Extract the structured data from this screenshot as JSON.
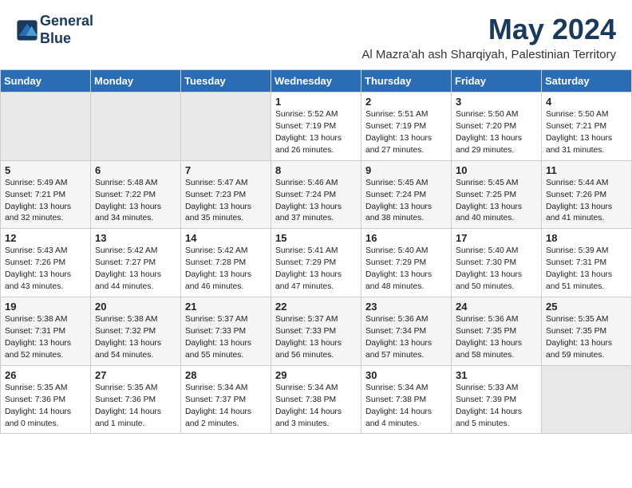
{
  "header": {
    "logo_line1": "General",
    "logo_line2": "Blue",
    "month": "May 2024",
    "location": "Al Mazra'ah ash Sharqiyah, Palestinian Territory"
  },
  "weekdays": [
    "Sunday",
    "Monday",
    "Tuesday",
    "Wednesday",
    "Thursday",
    "Friday",
    "Saturday"
  ],
  "weeks": [
    [
      {
        "day": "",
        "content": ""
      },
      {
        "day": "",
        "content": ""
      },
      {
        "day": "",
        "content": ""
      },
      {
        "day": "1",
        "content": "Sunrise: 5:52 AM\nSunset: 7:19 PM\nDaylight: 13 hours\nand 26 minutes."
      },
      {
        "day": "2",
        "content": "Sunrise: 5:51 AM\nSunset: 7:19 PM\nDaylight: 13 hours\nand 27 minutes."
      },
      {
        "day": "3",
        "content": "Sunrise: 5:50 AM\nSunset: 7:20 PM\nDaylight: 13 hours\nand 29 minutes."
      },
      {
        "day": "4",
        "content": "Sunrise: 5:50 AM\nSunset: 7:21 PM\nDaylight: 13 hours\nand 31 minutes."
      }
    ],
    [
      {
        "day": "5",
        "content": "Sunrise: 5:49 AM\nSunset: 7:21 PM\nDaylight: 13 hours\nand 32 minutes."
      },
      {
        "day": "6",
        "content": "Sunrise: 5:48 AM\nSunset: 7:22 PM\nDaylight: 13 hours\nand 34 minutes."
      },
      {
        "day": "7",
        "content": "Sunrise: 5:47 AM\nSunset: 7:23 PM\nDaylight: 13 hours\nand 35 minutes."
      },
      {
        "day": "8",
        "content": "Sunrise: 5:46 AM\nSunset: 7:24 PM\nDaylight: 13 hours\nand 37 minutes."
      },
      {
        "day": "9",
        "content": "Sunrise: 5:45 AM\nSunset: 7:24 PM\nDaylight: 13 hours\nand 38 minutes."
      },
      {
        "day": "10",
        "content": "Sunrise: 5:45 AM\nSunset: 7:25 PM\nDaylight: 13 hours\nand 40 minutes."
      },
      {
        "day": "11",
        "content": "Sunrise: 5:44 AM\nSunset: 7:26 PM\nDaylight: 13 hours\nand 41 minutes."
      }
    ],
    [
      {
        "day": "12",
        "content": "Sunrise: 5:43 AM\nSunset: 7:26 PM\nDaylight: 13 hours\nand 43 minutes."
      },
      {
        "day": "13",
        "content": "Sunrise: 5:42 AM\nSunset: 7:27 PM\nDaylight: 13 hours\nand 44 minutes."
      },
      {
        "day": "14",
        "content": "Sunrise: 5:42 AM\nSunset: 7:28 PM\nDaylight: 13 hours\nand 46 minutes."
      },
      {
        "day": "15",
        "content": "Sunrise: 5:41 AM\nSunset: 7:29 PM\nDaylight: 13 hours\nand 47 minutes."
      },
      {
        "day": "16",
        "content": "Sunrise: 5:40 AM\nSunset: 7:29 PM\nDaylight: 13 hours\nand 48 minutes."
      },
      {
        "day": "17",
        "content": "Sunrise: 5:40 AM\nSunset: 7:30 PM\nDaylight: 13 hours\nand 50 minutes."
      },
      {
        "day": "18",
        "content": "Sunrise: 5:39 AM\nSunset: 7:31 PM\nDaylight: 13 hours\nand 51 minutes."
      }
    ],
    [
      {
        "day": "19",
        "content": "Sunrise: 5:38 AM\nSunset: 7:31 PM\nDaylight: 13 hours\nand 52 minutes."
      },
      {
        "day": "20",
        "content": "Sunrise: 5:38 AM\nSunset: 7:32 PM\nDaylight: 13 hours\nand 54 minutes."
      },
      {
        "day": "21",
        "content": "Sunrise: 5:37 AM\nSunset: 7:33 PM\nDaylight: 13 hours\nand 55 minutes."
      },
      {
        "day": "22",
        "content": "Sunrise: 5:37 AM\nSunset: 7:33 PM\nDaylight: 13 hours\nand 56 minutes."
      },
      {
        "day": "23",
        "content": "Sunrise: 5:36 AM\nSunset: 7:34 PM\nDaylight: 13 hours\nand 57 minutes."
      },
      {
        "day": "24",
        "content": "Sunrise: 5:36 AM\nSunset: 7:35 PM\nDaylight: 13 hours\nand 58 minutes."
      },
      {
        "day": "25",
        "content": "Sunrise: 5:35 AM\nSunset: 7:35 PM\nDaylight: 13 hours\nand 59 minutes."
      }
    ],
    [
      {
        "day": "26",
        "content": "Sunrise: 5:35 AM\nSunset: 7:36 PM\nDaylight: 14 hours\nand 0 minutes."
      },
      {
        "day": "27",
        "content": "Sunrise: 5:35 AM\nSunset: 7:36 PM\nDaylight: 14 hours\nand 1 minute."
      },
      {
        "day": "28",
        "content": "Sunrise: 5:34 AM\nSunset: 7:37 PM\nDaylight: 14 hours\nand 2 minutes."
      },
      {
        "day": "29",
        "content": "Sunrise: 5:34 AM\nSunset: 7:38 PM\nDaylight: 14 hours\nand 3 minutes."
      },
      {
        "day": "30",
        "content": "Sunrise: 5:34 AM\nSunset: 7:38 PM\nDaylight: 14 hours\nand 4 minutes."
      },
      {
        "day": "31",
        "content": "Sunrise: 5:33 AM\nSunset: 7:39 PM\nDaylight: 14 hours\nand 5 minutes."
      },
      {
        "day": "",
        "content": ""
      }
    ]
  ]
}
